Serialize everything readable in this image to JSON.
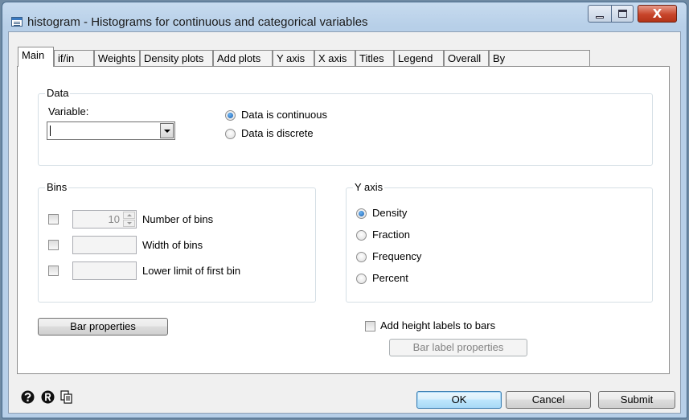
{
  "window": {
    "title": "histogram - Histograms for continuous and categorical variables",
    "close_glyph": "X"
  },
  "tabs": [
    {
      "label": "Main",
      "active": true
    },
    {
      "label": "if/in"
    },
    {
      "label": "Weights"
    },
    {
      "label": "Density plots"
    },
    {
      "label": "Add plots"
    },
    {
      "label": "Y axis"
    },
    {
      "label": "X axis"
    },
    {
      "label": "Titles"
    },
    {
      "label": "Legend"
    },
    {
      "label": "Overall"
    },
    {
      "label": "By"
    }
  ],
  "data_group": {
    "title": "Data",
    "variable_label": "Variable:",
    "variable_value": "",
    "continuous_label": "Data is continuous",
    "discrete_label": "Data is discrete",
    "selected": "continuous"
  },
  "bins_group": {
    "title": "Bins",
    "number_label": "Number of bins",
    "number_value": "10",
    "width_label": "Width of bins",
    "lower_label": "Lower limit of first bin"
  },
  "yaxis_group": {
    "title": "Y axis",
    "options": [
      "Density",
      "Fraction",
      "Frequency",
      "Percent"
    ],
    "selected": "Density"
  },
  "bar_properties_label": "Bar properties",
  "height_labels_label": "Add height labels to bars",
  "bar_label_properties_label": "Bar label properties",
  "footer": {
    "ok": "OK",
    "cancel": "Cancel",
    "submit": "Submit",
    "icons": [
      "help-icon",
      "reset-icon",
      "copy-command-icon"
    ]
  }
}
